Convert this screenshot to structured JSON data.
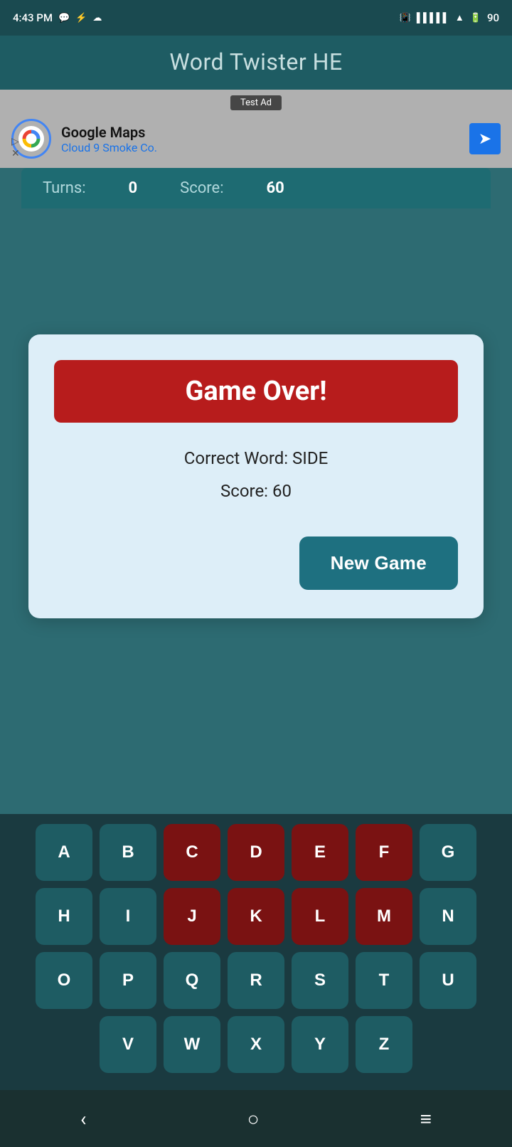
{
  "statusBar": {
    "time": "4:43 PM",
    "battery": "90"
  },
  "header": {
    "title": "Word Twister HE"
  },
  "ad": {
    "label": "Test Ad",
    "mainText": "Google Maps",
    "subText": "Cloud 9 Smoke Co."
  },
  "gameInfo": {
    "turnsLabel": "Turns:",
    "turnsValue": "0",
    "scoreLabel": "Score:",
    "scoreValue": "60"
  },
  "modal": {
    "gameOverText": "Game Over!",
    "correctWordLabel": "Correct Word: SIDE",
    "scoreText": "Score: 60",
    "newGameButton": "New Game"
  },
  "keyboard": {
    "rows": [
      [
        "A",
        "B",
        "C",
        "D",
        "E",
        "F",
        "G"
      ],
      [
        "H",
        "I",
        "J",
        "K",
        "L",
        "M",
        "N"
      ],
      [
        "O",
        "P",
        "Q",
        "R",
        "S",
        "T",
        "U"
      ],
      [
        "V",
        "W",
        "X",
        "Y",
        "Z"
      ]
    ],
    "darkRedKeys": [
      "C",
      "D",
      "E",
      "F",
      "J",
      "K",
      "L",
      "M"
    ]
  },
  "navBar": {
    "backIcon": "‹",
    "homeIcon": "○",
    "menuIcon": "≡"
  },
  "colors": {
    "appHeader": "#1e5c63",
    "keyNormal": "#1e5c63",
    "keyDarkRed": "#7a1212",
    "modalBg": "#ddeef8",
    "gameOverRed": "#b71c1c",
    "newGameBtn": "#1e7080"
  }
}
